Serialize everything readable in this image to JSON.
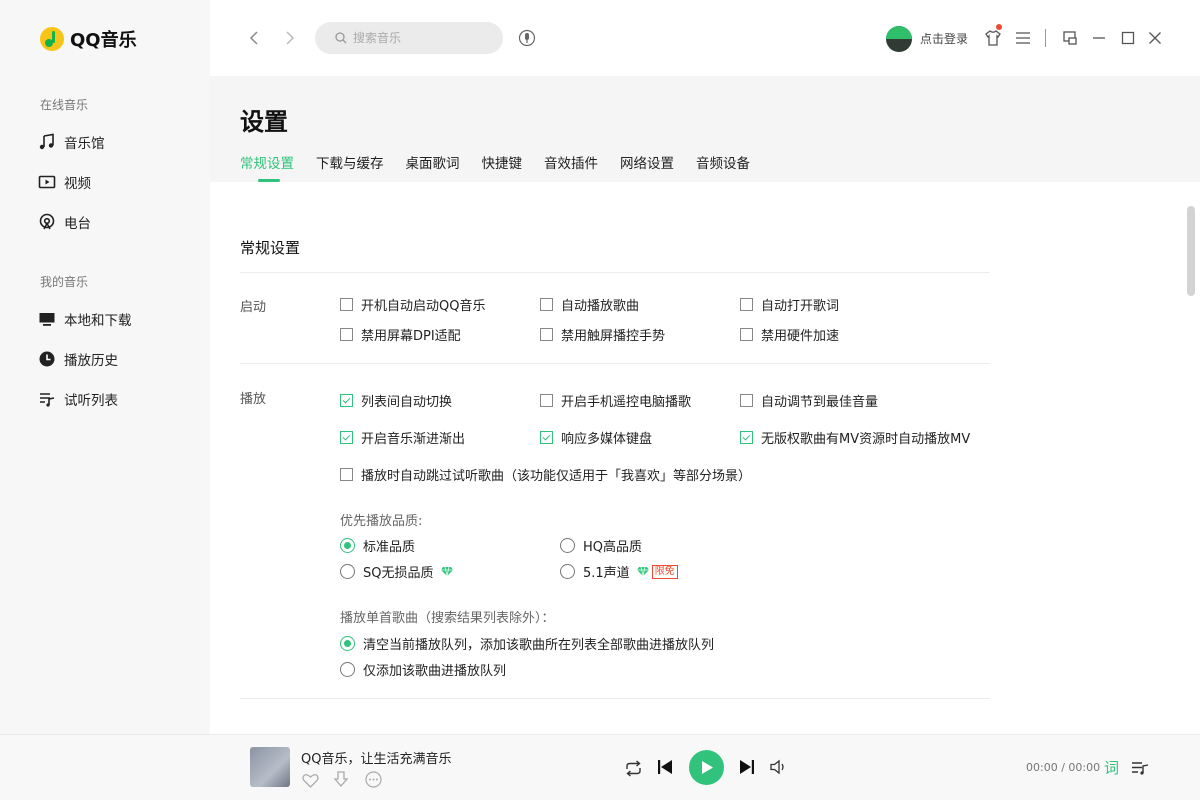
{
  "app": {
    "name": "QQ音乐"
  },
  "sidebar": {
    "online_title": "在线音乐",
    "online_items": [
      {
        "label": "音乐馆",
        "icon": "music-note-icon"
      },
      {
        "label": "视频",
        "icon": "video-icon"
      },
      {
        "label": "电台",
        "icon": "radio-icon"
      }
    ],
    "my_title": "我的音乐",
    "my_items": [
      {
        "label": "本地和下载",
        "icon": "monitor-icon"
      },
      {
        "label": "播放历史",
        "icon": "clock-icon"
      },
      {
        "label": "试听列表",
        "icon": "playlist-icon"
      }
    ]
  },
  "topbar": {
    "search_placeholder": "搜索音乐",
    "login_label": "点击登录"
  },
  "settings": {
    "title": "设置",
    "tabs": [
      "常规设置",
      "下载与缓存",
      "桌面歌词",
      "快捷键",
      "音效插件",
      "网络设置",
      "音频设备"
    ],
    "active_tab": "常规设置",
    "section_title": "常规设置",
    "startup": {
      "label": "启动",
      "options": [
        {
          "label": "开机自动启动QQ音乐",
          "checked": false
        },
        {
          "label": "自动播放歌曲",
          "checked": false
        },
        {
          "label": "自动打开歌词",
          "checked": false
        },
        {
          "label": "禁用屏幕DPI适配",
          "checked": false
        },
        {
          "label": "禁用触屏播控手势",
          "checked": false
        },
        {
          "label": "禁用硬件加速",
          "checked": false
        }
      ]
    },
    "playback": {
      "label": "播放",
      "options": [
        {
          "label": "列表间自动切换",
          "checked": true
        },
        {
          "label": "开启手机遥控电脑播歌",
          "checked": false
        },
        {
          "label": "自动调节到最佳音量",
          "checked": false
        },
        {
          "label": "开启音乐渐进渐出",
          "checked": true
        },
        {
          "label": "响应多媒体键盘",
          "checked": true
        },
        {
          "label": "无版权歌曲有MV资源时自动播放MV",
          "checked": true
        },
        {
          "label": "播放时自动跳过试听歌曲（该功能仅适用于「我喜欢」等部分场景）",
          "checked": false
        }
      ],
      "quality_label": "优先播放品质:",
      "quality_options": [
        {
          "label": "标准品质",
          "selected": true
        },
        {
          "label": "HQ高品质",
          "selected": false
        },
        {
          "label": "SQ无损品质",
          "selected": false
        },
        {
          "label": "5.1声道",
          "selected": false,
          "badge": "限免"
        }
      ],
      "single_label": "播放单首歌曲（搜索结果列表除外）：",
      "single_options": [
        {
          "label": "清空当前播放队列，添加该歌曲所在列表全部歌曲进播放队列",
          "selected": true
        },
        {
          "label": "仅添加该歌曲进播放队列",
          "selected": false
        }
      ]
    }
  },
  "player": {
    "song_title": "QQ音乐，让生活充满音乐",
    "time": "00:00 / 00:00",
    "lyric_label": "词"
  },
  "colors": {
    "accent": "#31c27c",
    "badge": "#ef4a2d"
  }
}
